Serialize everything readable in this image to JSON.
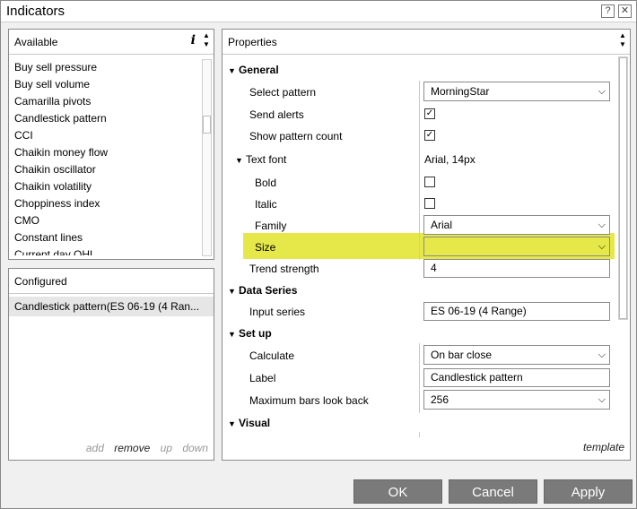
{
  "window": {
    "title": "Indicators"
  },
  "titlebar_buttons": {
    "help": "?",
    "close": "✕"
  },
  "available": {
    "header": "Available",
    "info_icon": "i",
    "items": [
      "Buy sell pressure",
      "Buy sell volume",
      "Camarilla pivots",
      "Candlestick pattern",
      "CCI",
      "Chaikin money flow",
      "Chaikin oscillator",
      "Chaikin volatility",
      "Choppiness index",
      "CMO",
      "Constant lines",
      "Current day OHL"
    ]
  },
  "configured": {
    "header": "Configured",
    "items": [
      "Candlestick pattern(ES 06-19 (4 Ran..."
    ],
    "actions": {
      "add": "add",
      "remove": "remove",
      "up": "up",
      "down": "down"
    }
  },
  "properties": {
    "header": "Properties",
    "sections": {
      "general": "General",
      "data_series": "Data Series",
      "setup": "Set up",
      "visual": "Visual"
    },
    "rows": {
      "select_pattern": {
        "label": "Select pattern",
        "value": "MorningStar"
      },
      "send_alerts": {
        "label": "Send alerts",
        "checked": true
      },
      "show_pattern_count": {
        "label": "Show pattern count",
        "checked": true
      },
      "text_font": {
        "label": "Text font",
        "value": "Arial, 14px"
      },
      "bold": {
        "label": "Bold",
        "checked": false
      },
      "italic": {
        "label": "Italic",
        "checked": false
      },
      "family": {
        "label": "Family",
        "value": "Arial"
      },
      "size": {
        "label": "Size",
        "value": ""
      },
      "trend_strength": {
        "label": "Trend strength",
        "value": "4"
      },
      "input_series": {
        "label": "Input series",
        "value": "ES 06-19 (4 Range)"
      },
      "calculate": {
        "label": "Calculate",
        "value": "On bar close"
      },
      "label": {
        "label": "Label",
        "value": "Candlestick pattern"
      },
      "max_bars": {
        "label": "Maximum bars look back",
        "value": "256"
      }
    },
    "template": "template",
    "highlight_color": "#e6e84a"
  },
  "buttons": {
    "ok": "OK",
    "cancel": "Cancel",
    "apply": "Apply"
  },
  "glyphs": {
    "check": "✓",
    "chevron": "⌄",
    "tri_down": "▼",
    "arrow_up": "▲",
    "arrow_down": "▼"
  }
}
